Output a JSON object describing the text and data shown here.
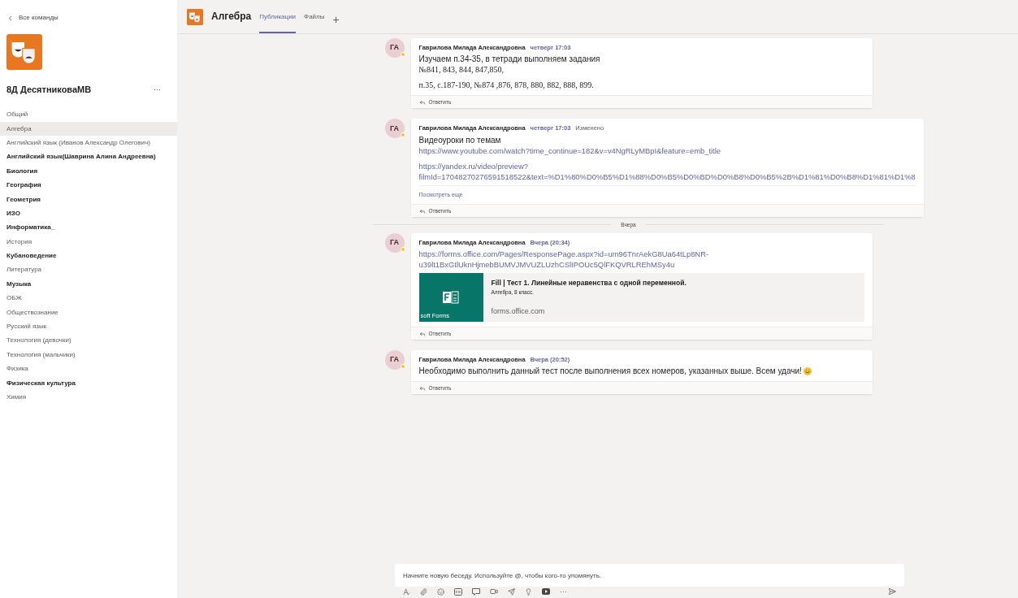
{
  "sidebar": {
    "back_label": "Все команды",
    "team_name": "8Д ДесятниковаМВ",
    "more": "···",
    "channels": [
      {
        "name": "Общий",
        "unread": false,
        "selected": false
      },
      {
        "name": "Алгебра",
        "unread": false,
        "selected": true
      },
      {
        "name": "Английский язык (Иванов Александр Олегович)",
        "unread": false,
        "selected": false
      },
      {
        "name": "Английский язык(Шаврина Алина Андреевна)",
        "unread": true,
        "selected": false
      },
      {
        "name": "Биология",
        "unread": true,
        "selected": false
      },
      {
        "name": "География",
        "unread": true,
        "selected": false
      },
      {
        "name": "Геометрия",
        "unread": true,
        "selected": false
      },
      {
        "name": "ИЗО",
        "unread": true,
        "selected": false
      },
      {
        "name": "Информатика_",
        "unread": true,
        "selected": false
      },
      {
        "name": "История",
        "unread": false,
        "selected": false
      },
      {
        "name": "Кубановедение",
        "unread": true,
        "selected": false
      },
      {
        "name": "Литература",
        "unread": false,
        "selected": false
      },
      {
        "name": "Музыка",
        "unread": true,
        "selected": false
      },
      {
        "name": "ОБЖ",
        "unread": false,
        "selected": false
      },
      {
        "name": "Обществознание",
        "unread": false,
        "selected": false
      },
      {
        "name": "Русский язык",
        "unread": false,
        "selected": false
      },
      {
        "name": "Технология (девочки)",
        "unread": false,
        "selected": false
      },
      {
        "name": "Технология (мальчики)",
        "unread": false,
        "selected": false
      },
      {
        "name": "Физика",
        "unread": false,
        "selected": false
      },
      {
        "name": "Физическая культура",
        "unread": true,
        "selected": false
      },
      {
        "name": "Химия",
        "unread": false,
        "selected": false
      }
    ]
  },
  "header": {
    "channel": "Алгебра",
    "tabs": [
      {
        "label": "Публикации",
        "selected": true
      },
      {
        "label": "Файлы",
        "selected": false
      }
    ],
    "add": "+"
  },
  "feed": [
    {
      "kind": "message",
      "avatar": "ГА",
      "author": "Гаврилова Милада Александровна",
      "time": "четверг 17:03",
      "paragraphs": [
        [
          {
            "kind": "text",
            "text": "Изучаем п.34-35, в тетради выполняем задания"
          },
          {
            "kind": "serif",
            "text": "№841, 843, 844, 847,850,"
          }
        ],
        [
          {
            "kind": "serif",
            "text": "п.35, с.187-190, №874 ,876, 878, 880, 882, 888, 899."
          }
        ]
      ],
      "reply": "Ответить"
    },
    {
      "kind": "message",
      "avatar": "ГА",
      "author": "Гаврилова Милада Александровна",
      "time": "четверг 17:03",
      "edited": "Изменено",
      "paragraphs": [
        [
          {
            "kind": "text",
            "text": "Видеоуроки по темам"
          },
          {
            "kind": "link",
            "text": "https://www.youtube.com/watch?time_continue=182&v=v4NgRLyMBpI&feature=emb_title"
          }
        ],
        [
          {
            "kind": "link",
            "text": "https://yandex.ru/video/preview?"
          },
          {
            "kind": "link",
            "text": "filmId=17048270276591518522&text=%D1%80%D0%B5%D1%88%D0%B5%D0%BD%D0%B8%D0%B5%2B%D1%81%D0%B8%D1%81%D1%8"
          }
        ]
      ],
      "see_more": "Посмотреть еще",
      "reply": "Ответить"
    },
    {
      "kind": "divider",
      "label": "Вчера"
    },
    {
      "kind": "message",
      "avatar": "ГА",
      "author": "Гаврилова Милада Александровна",
      "time": "Вчера (20:34)",
      "paragraphs": [
        [
          {
            "kind": "link",
            "text": "https://forms.office.com/Pages/ResponsePage.aspx?id=um96TnrAekG8Ua64tLp8NR-"
          },
          {
            "kind": "link",
            "text": "u39lt1BxGtlUknHjmebBUMVJMVUZLUzhCSlIPOUc5QlFKQVRLREhMSy4u"
          }
        ]
      ],
      "preview": {
        "thumb_caption": "soft Forms",
        "title": "Fill | Тест 1. Линейные неравенства с одной переменной.",
        "subtitle": "Алгебра, 8 класс.",
        "domain": "forms.office.com"
      },
      "reply": "Ответить"
    },
    {
      "kind": "message",
      "avatar": "ГА",
      "author": "Гаврилова Милада Александровна",
      "time": "Вчера (20:52)",
      "paragraphs": [
        [
          {
            "kind": "text",
            "text": "Необходимо выполнить данный тест после выполнения всех номеров, указанных выше. Всем удачи!",
            "emoji": true
          }
        ]
      ],
      "reply": "Ответить"
    }
  ],
  "composer": {
    "placeholder": "Начните новую беседу. Используйте @, чтобы кого-то упомянуть.",
    "more": "···"
  }
}
